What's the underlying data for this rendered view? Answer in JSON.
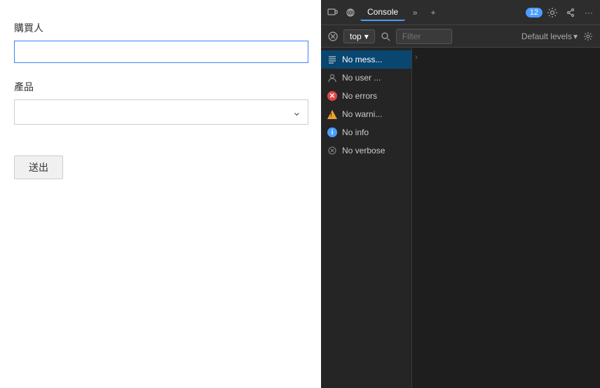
{
  "form": {
    "buyer_label": "購買人",
    "buyer_placeholder": "",
    "product_label": "產品",
    "product_placeholder": "",
    "submit_label": "送出"
  },
  "devtools": {
    "tab_console": "Console",
    "badge_count": "12",
    "topbar_icons": [
      "device-icon",
      "network-icon",
      "more-icon",
      "add-icon",
      "gear-icon",
      "share-icon",
      "ellipsis-icon"
    ],
    "toolbar": {
      "top_label": "top",
      "filter_placeholder": "Filter",
      "levels_label": "Default levels",
      "search_icon": "🔍",
      "clear_icon": "🚫",
      "gear_label": "⚙"
    },
    "sidebar_items": [
      {
        "id": "messages",
        "icon": "list-icon",
        "label": "No mess...",
        "active": true
      },
      {
        "id": "user",
        "icon": "user-icon",
        "label": "No user ..."
      },
      {
        "id": "errors",
        "icon": "error-icon",
        "label": "No errors"
      },
      {
        "id": "warnings",
        "icon": "warning-icon",
        "label": "No warni..."
      },
      {
        "id": "info",
        "icon": "info-icon",
        "label": "No info"
      },
      {
        "id": "verbose",
        "icon": "verbose-icon",
        "label": "No verbose"
      }
    ]
  }
}
